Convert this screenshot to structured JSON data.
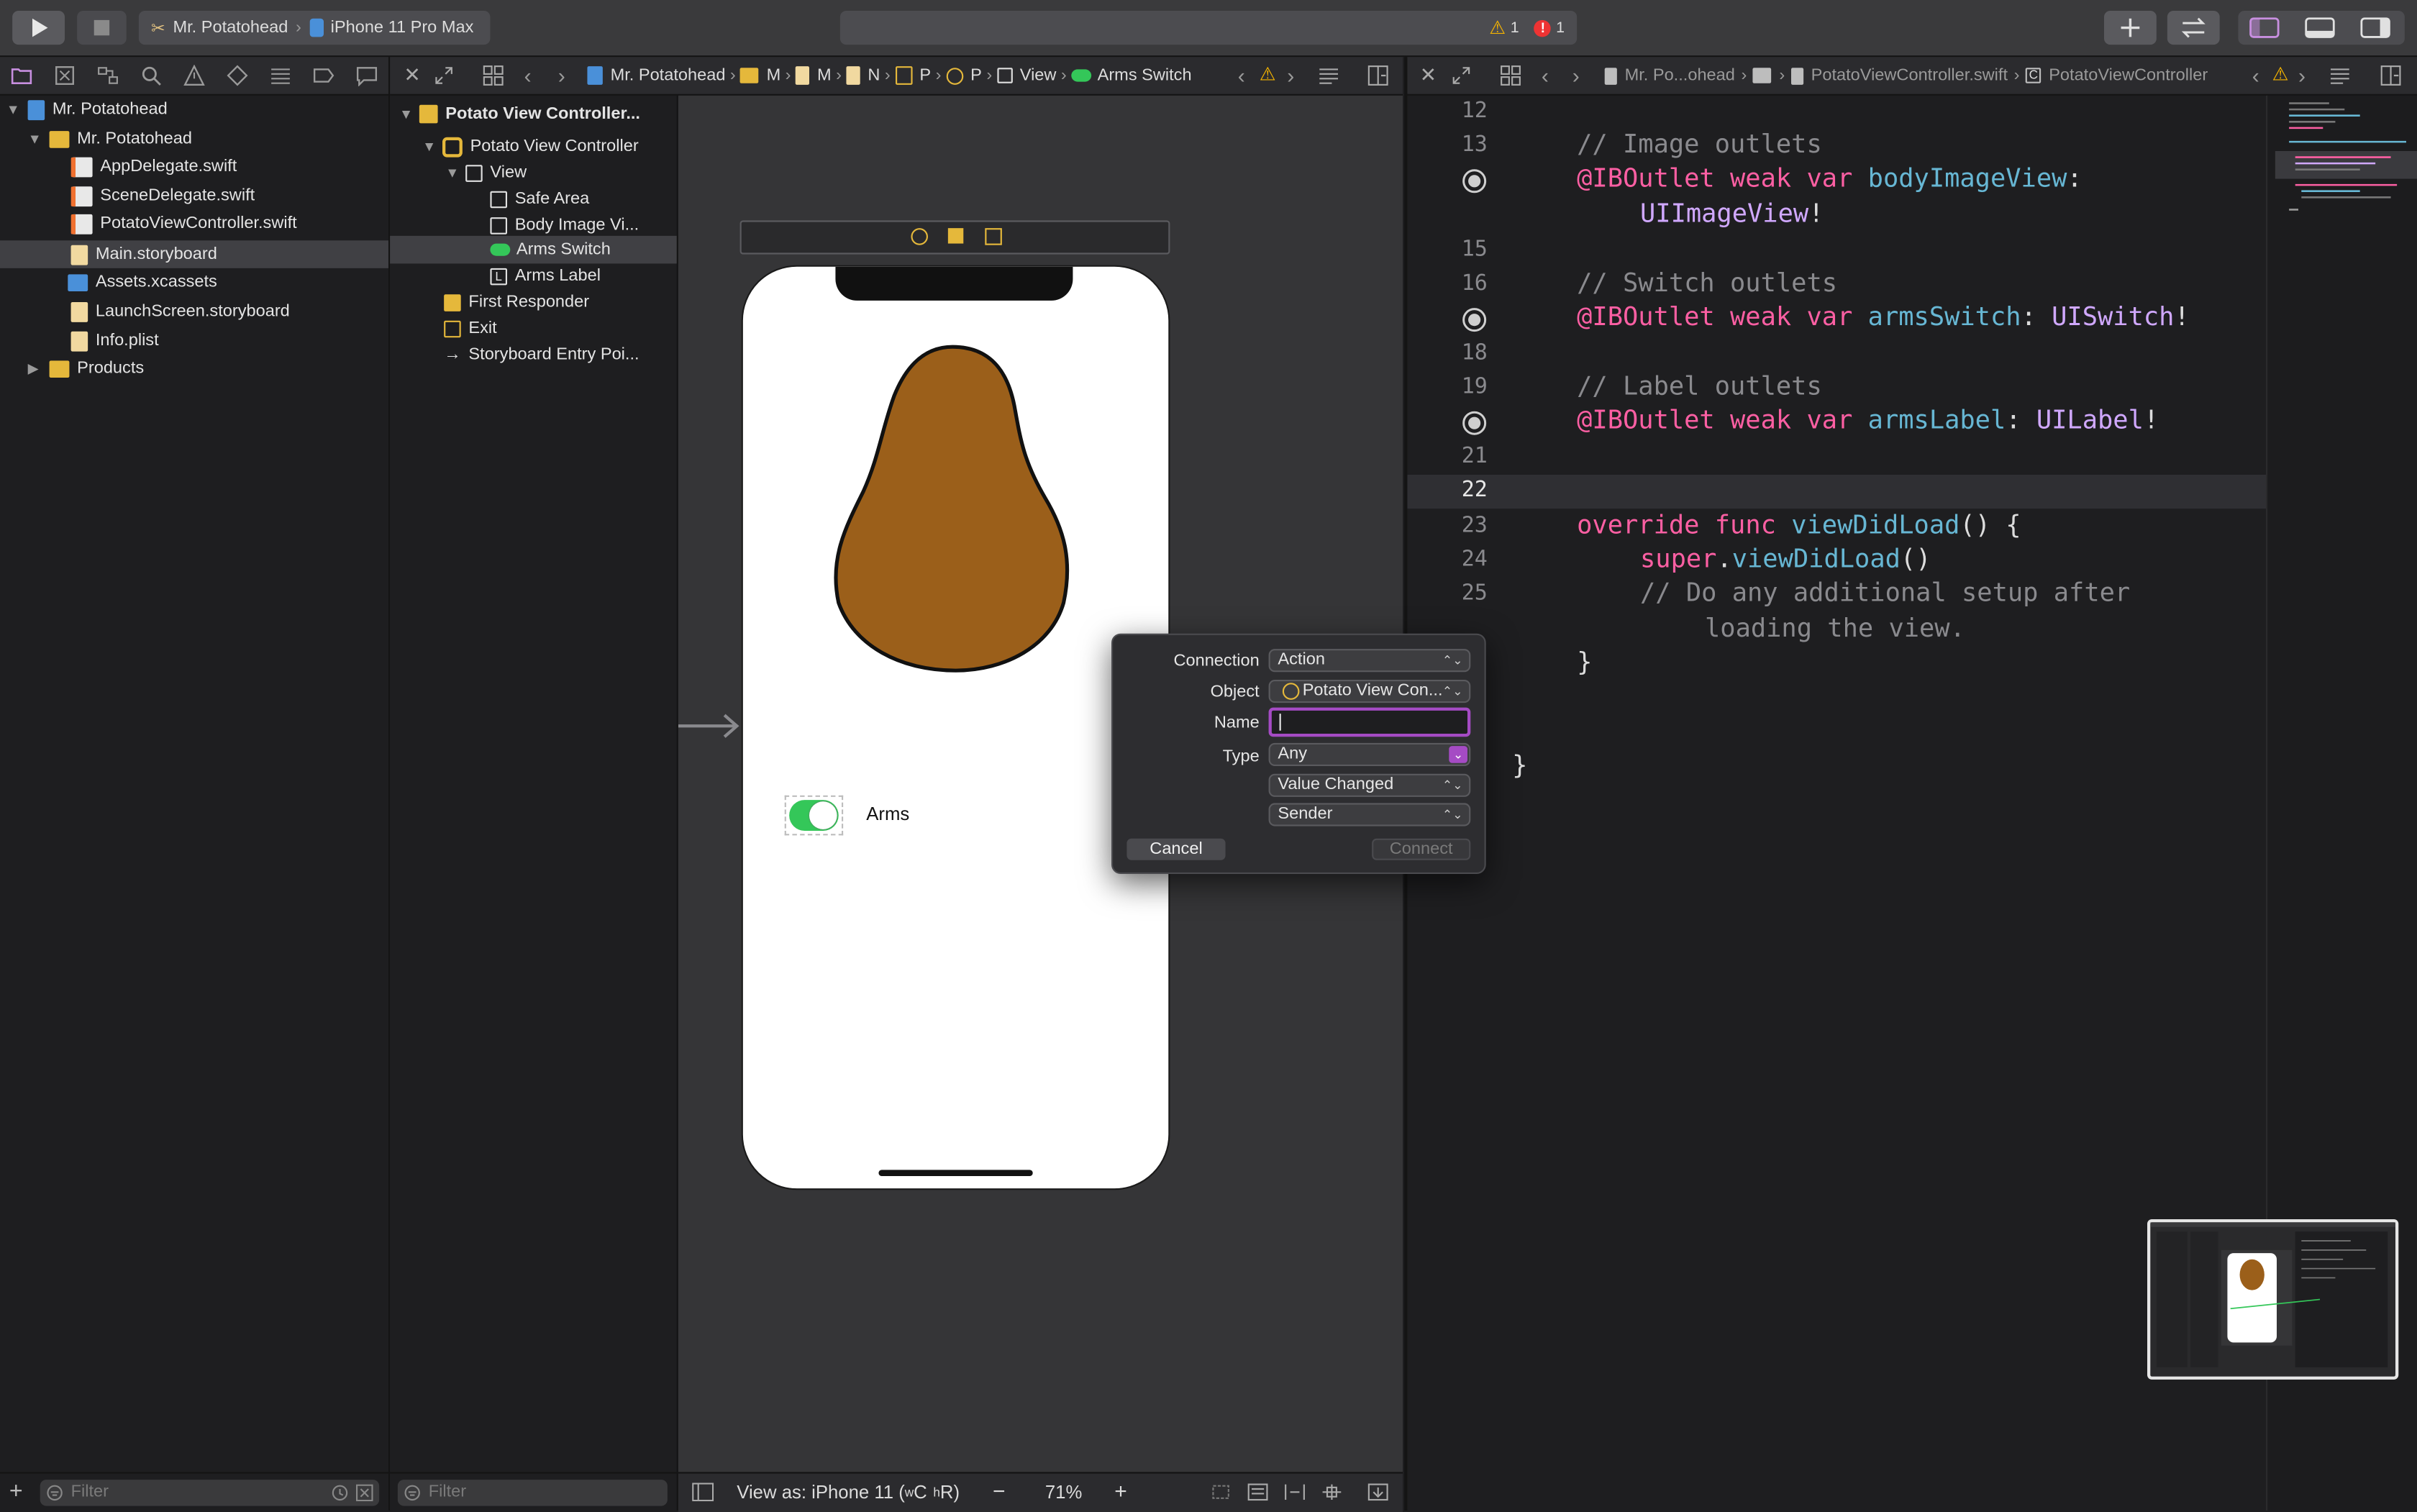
{
  "toolbar": {
    "scheme": "Mr. Potatohead",
    "device": "iPhone 11 Pro Max",
    "warning_count": "1",
    "error_count": "1"
  },
  "navigator": {
    "project": "Mr. Potatohead",
    "group": "Mr. Potatohead",
    "files": [
      "AppDelegate.swift",
      "SceneDelegate.swift",
      "PotatoViewController.swift",
      "Main.storyboard",
      "Assets.xcassets",
      "LaunchScreen.storyboard",
      "Info.plist"
    ],
    "products": "Products",
    "filter_placeholder": "Filter"
  },
  "ib_jumpbar": {
    "items": [
      "Mr. Potatohead",
      "M",
      "M",
      "N",
      "P",
      "P",
      "View",
      "Arms Switch"
    ]
  },
  "outline": {
    "scene": "Potato View Controller...",
    "controller": "Potato View Controller",
    "view": "View",
    "children": [
      "Safe Area",
      "Body Image Vi...",
      "Arms Switch",
      "Arms Label"
    ],
    "first_responder": "First Responder",
    "exit": "Exit",
    "entry_point": "Storyboard Entry Poi...",
    "filter_placeholder": "Filter"
  },
  "canvas": {
    "arms_label": "Arms",
    "view_as": "View as: iPhone 11 (",
    "view_as_wC": "w",
    "view_as_C": "C",
    "view_as_hR_h": "h",
    "view_as_R": "R)",
    "zoom": "71%"
  },
  "popover": {
    "connection_label": "Connection",
    "connection_value": "Action",
    "object_label": "Object",
    "object_value": "Potato View Con...",
    "name_label": "Name",
    "name_value": "",
    "type_label": "Type",
    "type_value": "Any",
    "event_value": "Value Changed",
    "arguments_value": "Sender",
    "cancel": "Cancel",
    "connect": "Connect"
  },
  "editor_jumpbar": {
    "project": "Mr. Po...ohead",
    "file": "PotatoViewController.swift",
    "symbol": "PotatoViewController"
  },
  "code": {
    "line_numbers": [
      "12",
      "13",
      "15",
      "16",
      "18",
      "19",
      "21",
      "22",
      "23",
      "24",
      "25"
    ],
    "c1": "// Image outlets",
    "o1_a": "@IBOutlet",
    "o1_b": "weak",
    "o1_c": "var",
    "o1_d": "bodyImageView",
    "o1_e": ":",
    "o1_f": "UIImageView",
    "o1_g": "!",
    "c2": "// Switch outlets",
    "o2_d": "armsSwitch",
    "o2_f": "UISwitch",
    "c3": "// Label outlets",
    "o3_d": "armsLabel",
    "o3_f": "UILabel",
    "f_kw1": "override",
    "f_kw2": "func",
    "f_name": "viewDidLoad",
    "f_rest": "() {",
    "s_kw": "super",
    "s_dot": ".",
    "s_call": "viewDidLoad",
    "s_rest": "()",
    "c4": "// Do any additional setup after",
    "c5": "loading the view.",
    "close1": "}",
    "close2": "}"
  },
  "colors": {
    "potato": "#9b5f1a",
    "switch_on": "#34c759",
    "keyword": "#fc5fa3",
    "identifier": "#67b7d4",
    "type": "#d0a8ff",
    "comment": "#8a8a8e",
    "focus": "#a54bc4"
  }
}
